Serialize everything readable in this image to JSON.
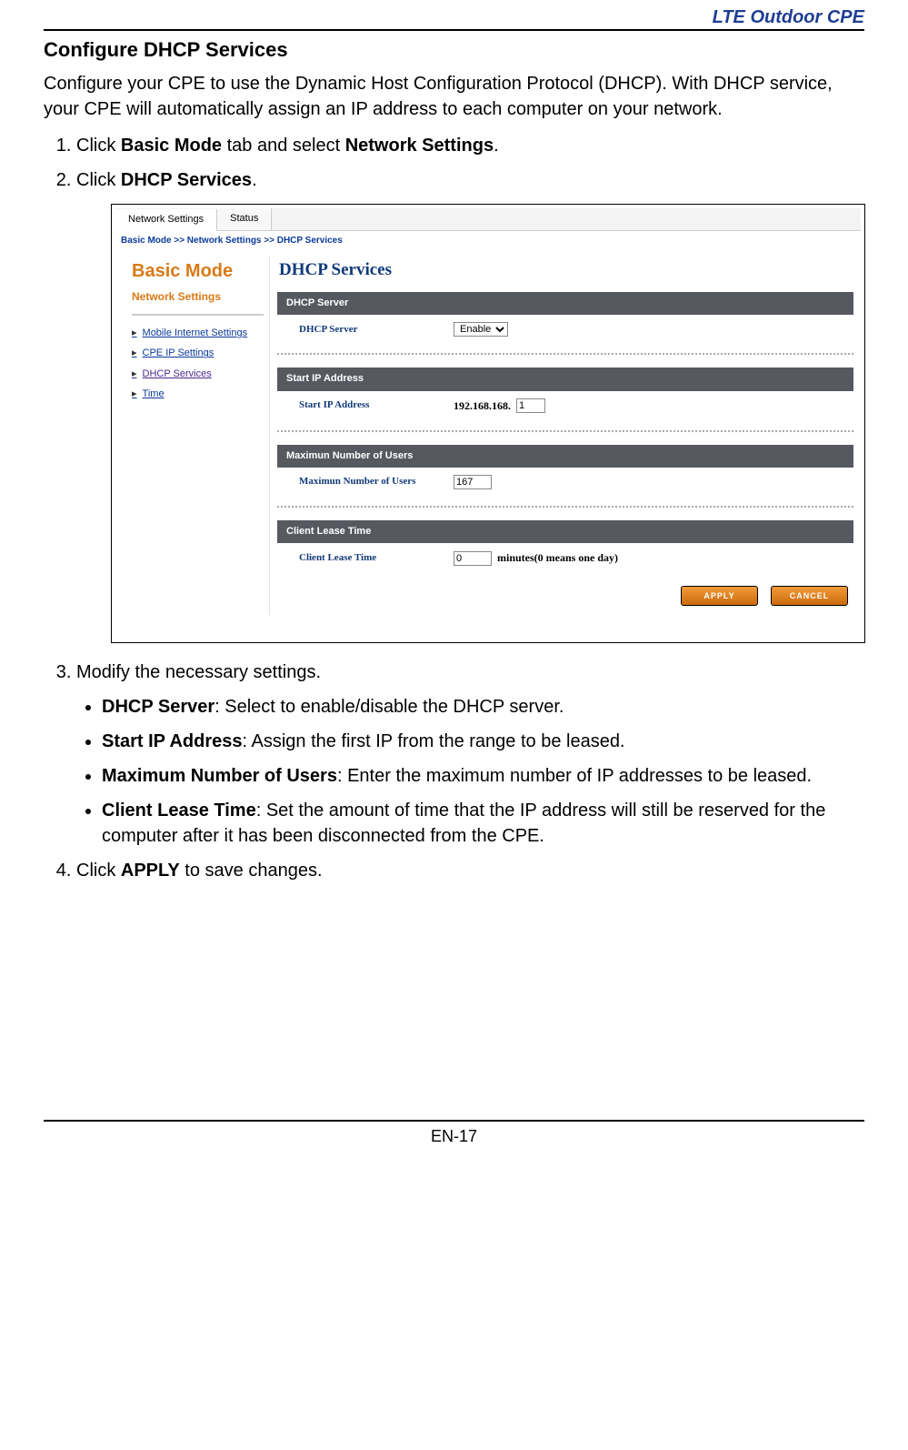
{
  "doc": {
    "header_label": "LTE Outdoor CPE",
    "section_title": "Configure DHCP Services",
    "intro": "Configure your CPE to use the Dynamic Host Configuration Protocol (DHCP). With DHCP service, your CPE will automatically assign an IP address to each computer on your network.",
    "step1_pre": "Click ",
    "step1_b1": "Basic Mode",
    "step1_mid": " tab and select ",
    "step1_b2": "Network Settings",
    "step1_post": ".",
    "step2_pre": "Click ",
    "step2_b1": "DHCP Services",
    "step2_post": ".",
    "step3": "Modify the necessary settings.",
    "bullet_dhcp_label": "DHCP Server",
    "bullet_dhcp_text": ": Select to enable/disable the DHCP server.",
    "bullet_start_label": "Start IP Address",
    "bullet_start_text": ": Assign the first IP from the range to be leased.",
    "bullet_max_label": "Maximum Number of Users",
    "bullet_max_text": ": Enter the maximum number of IP addresses to be leased.",
    "bullet_lease_label": "Client Lease Time",
    "bullet_lease_text": ": Set the amount of time that the IP address will still be reserved for the computer after it has been disconnected from the CPE.",
    "step4_pre": "Click ",
    "step4_b1": "APPLY",
    "step4_post": " to save changes.",
    "page_number": "EN-17"
  },
  "ui": {
    "tabs": [
      "Network Settings",
      "Status"
    ],
    "breadcrumb": "Basic Mode >> Network Settings >> DHCP Services",
    "mode_title": "Basic Mode",
    "mode_subtitle": "Network Settings",
    "sidebar": [
      "Mobile Internet Settings",
      "CPE IP Settings",
      "DHCP Services",
      "Time"
    ],
    "page_title": "DHCP Services",
    "dhcp_server": {
      "header": "DHCP Server",
      "label": "DHCP Server",
      "value": "Enable"
    },
    "start_ip": {
      "header": "Start IP Address",
      "label": "Start IP Address",
      "prefix": "192.168.168.",
      "value": "1"
    },
    "max_users": {
      "header": "Maximun Number of Users",
      "label": "Maximun Number of Users",
      "value": "167"
    },
    "lease": {
      "header": "Client Lease Time",
      "label": "Client Lease Time",
      "value": "0",
      "hint": "minutes(0 means one day)"
    },
    "buttons": {
      "apply": "APPLY",
      "cancel": "CANCEL"
    }
  }
}
